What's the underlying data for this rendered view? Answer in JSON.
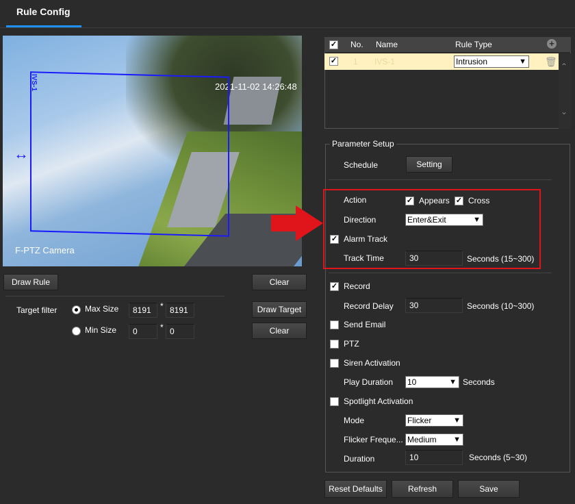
{
  "tab": {
    "title": "Rule Config"
  },
  "video": {
    "timestamp": "2021-11-02 14:26:48",
    "camera_name": "F-PTZ Camera",
    "rule_label": "IVS-1"
  },
  "left_panel": {
    "draw_rule": "Draw Rule",
    "clear1": "Clear",
    "target_filter": "Target filter",
    "max_size": "Max Size",
    "min_size": "Min Size",
    "max_w": "8191",
    "max_h": "8191",
    "min_w": "0",
    "min_h": "0",
    "times": "*",
    "draw_target": "Draw Target",
    "clear2": "Clear"
  },
  "rule_table": {
    "headers": {
      "no": "No.",
      "name": "Name",
      "type": "Rule Type"
    },
    "rows": [
      {
        "no": "1",
        "name": "IVS-1",
        "type": "Intrusion",
        "checked": true
      }
    ]
  },
  "params": {
    "legend": "Parameter Setup",
    "schedule": "Schedule",
    "setting": "Setting",
    "action": "Action",
    "appears": "Appears",
    "cross": "Cross",
    "direction": "Direction",
    "direction_value": "Enter&Exit",
    "alarm_track": "Alarm Track",
    "track_time": "Track Time",
    "track_time_value": "30",
    "track_time_unit": "Seconds (15~300)",
    "record": "Record",
    "record_delay": "Record Delay",
    "record_delay_value": "30",
    "record_delay_unit": "Seconds (10~300)",
    "send_email": "Send Email",
    "ptz": "PTZ",
    "siren": "Siren Activation",
    "play_duration": "Play Duration",
    "play_duration_value": "10",
    "play_duration_unit": "Seconds",
    "spotlight": "Spotlight Activation",
    "mode": "Mode",
    "mode_value": "Flicker",
    "flicker_freq": "Flicker Freque...",
    "flicker_freq_value": "Medium",
    "duration": "Duration",
    "duration_value": "10",
    "duration_unit": "Seconds (5~30)"
  },
  "footer": {
    "reset": "Reset Defaults",
    "refresh": "Refresh",
    "save": "Save"
  },
  "colors": {
    "accent": "#1e90ff",
    "highlight": "#e0141b",
    "rule_line": "#1a1aff"
  }
}
